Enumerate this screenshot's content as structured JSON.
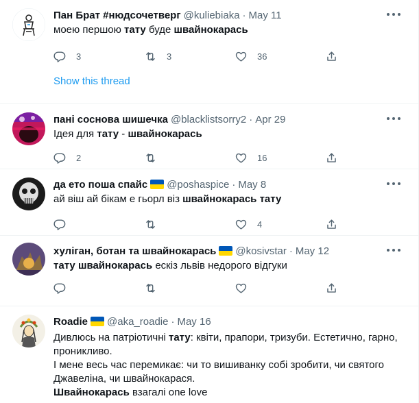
{
  "tweets": [
    {
      "name": "Пан Брат #нюдсочетверг",
      "handle": "@kuliebiaka",
      "sep": "·",
      "date": "May 11",
      "text": {
        "p1": "моею першою ",
        "b1": "тату",
        "p2": " буде ",
        "b2": "швайнокарась"
      },
      "reply_count": "3",
      "retweet_count": "3",
      "like_count": "36",
      "show_thread": "Show this thread"
    },
    {
      "name": "пані соснова шишечка",
      "handle": "@blacklistsorry2",
      "sep": "·",
      "date": "Apr 29",
      "text": {
        "p1": "Ідея для ",
        "b1": "тату",
        "p2": " - ",
        "b2": "швайнокарась"
      },
      "reply_count": "2",
      "retweet_count": "",
      "like_count": "16"
    },
    {
      "name": "да ето поша спайс",
      "handle": "@poshaspice",
      "sep": "·",
      "date": "May 8",
      "text": {
        "p1": "ай віш ай бікам е гьорл віз ",
        "b1": "швайнокарась",
        "p2": " ",
        "b2": "тату"
      },
      "reply_count": "",
      "retweet_count": "",
      "like_count": "4"
    },
    {
      "name": "хуліган, ботан та швайнокарась",
      "handle": "@kosivstar",
      "sep": "·",
      "date": "May 12",
      "text": {
        "b1": "тату",
        "p1": " ",
        "b2": "швайнокарась",
        "p2": " ескіз львів недорого відгуки"
      }
    },
    {
      "name": "Roadie",
      "handle": "@aka_roadie",
      "sep": "·",
      "date": "May 16",
      "text": {
        "p1": "Дивлюсь на патріотичні ",
        "b1": "тату",
        "p2": ": квіти, прапори, тризуби. Естетично, гарно, проникливо.",
        "line2": "І мене весь час перемикає: чи то вишиванку собі зробити, чи святого Джавеліна, чи швайнокарася.",
        "b2": "Швайнокарась",
        "p3": " взагалі one love"
      }
    }
  ],
  "colors": {
    "accent": "#1d9bf0",
    "muted": "#536471",
    "text": "#0f1419",
    "flag_blue": "#0057b7",
    "flag_yellow": "#ffd700"
  },
  "icons": [
    "reply-icon",
    "retweet-icon",
    "like-icon",
    "share-icon",
    "more-icon",
    "ukraine-flag-icon"
  ]
}
